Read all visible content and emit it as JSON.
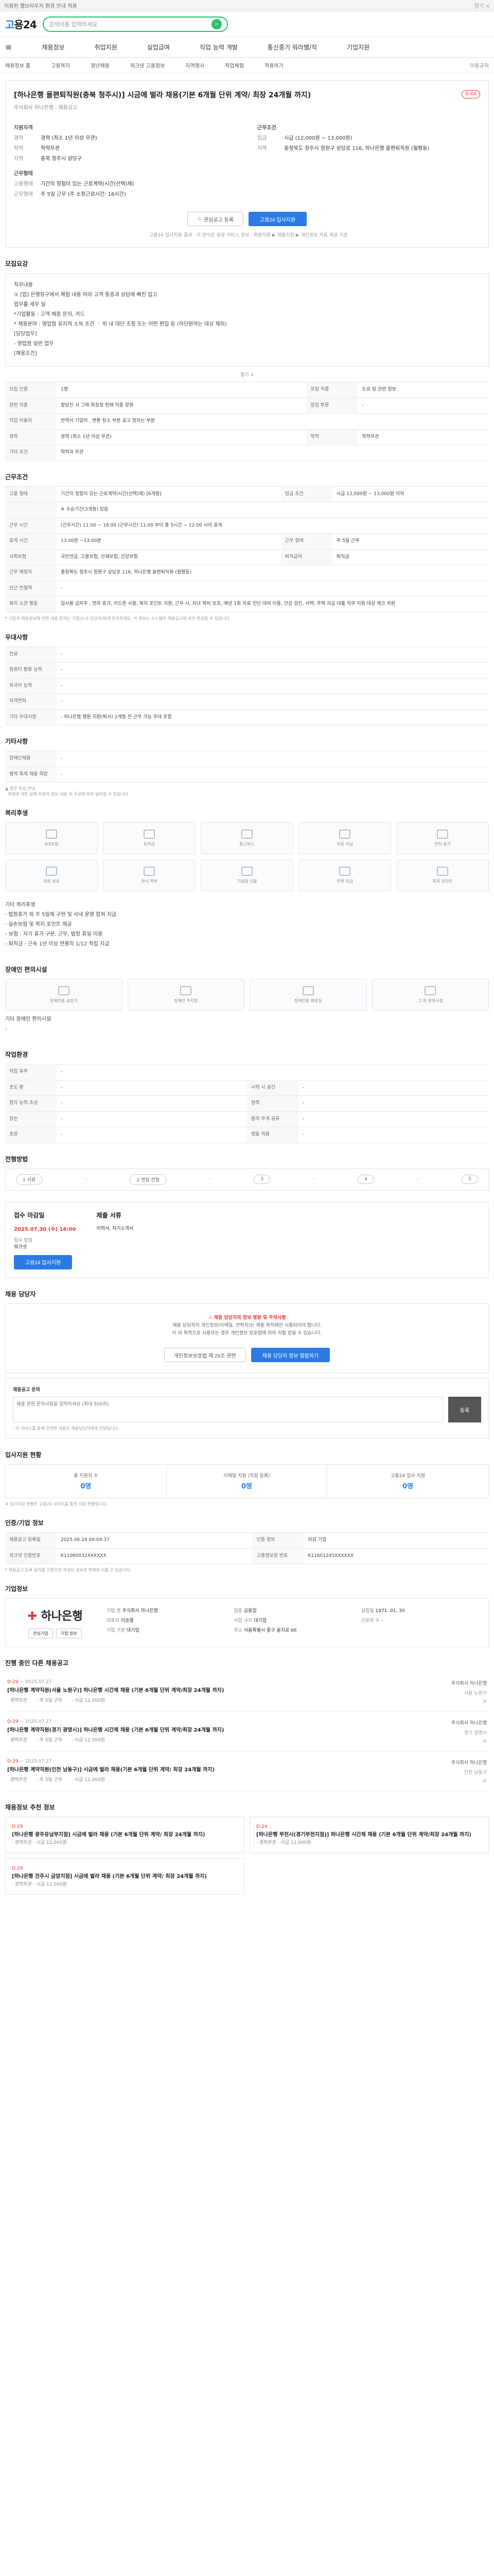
{
  "topbar": {
    "text": "이용된 웹브라우저 환경 안내 적용",
    "close": "닫기 ×"
  },
  "logo": {
    "a": "고",
    "b": "용24"
  },
  "search": {
    "placeholder": "검색어를 입력하세요"
  },
  "gnb": [
    "채용정보",
    "취업지원",
    "실업급여",
    "직업 능력 개발",
    "통신중기 워라밸/직",
    "기업지원"
  ],
  "lnb": [
    "채용정보 홈",
    "고용복지",
    "청년채용",
    "워크넷 고용정보",
    "지역행사",
    "직업체험",
    "적용하기",
    "이용규칙"
  ],
  "job": {
    "title": "[하나은행 을편퇴직원(충북 청주시)] 시금에 벌라 채용(기본 6개월 단위 계약/ 최장 24개월 까지)",
    "badge": "D-XX",
    "subtitle": "주식회사 하나은행 · 채용공고",
    "recruit_header": "지원자격",
    "career_header": "근무조건",
    "left": [
      {
        "k": "경력",
        "v": "경력 (최소 1년 이상 무관)"
      },
      {
        "k": "학력",
        "v": "학력무관"
      },
      {
        "k": "지역",
        "v": "충북 청주시 상당구"
      }
    ],
    "right": [
      {
        "k": "임금",
        "v": "시급 (12,000원 ~ 13,000원)"
      },
      {
        "k": "지역",
        "v": "충청북도 청주시 청원구 상당로 116, 하나은행 을편퇴직원 (월평동)"
      }
    ],
    "left2_header": "근무형태",
    "left2": [
      {
        "k": "고용형태",
        "v": "기간의 정함이 있는 근로계약(시간(선택)제)"
      },
      {
        "k": "근무형태",
        "v": "주 5일 근무 (주 소정근로시간: 16시간)"
      }
    ],
    "btn_scrap": "관심공고 등록",
    "btn_apply": "고용24 입사지원",
    "notice": "· 고용24 입사지원 결과 · 이 양식은 공공 서비스 정보 · 회원지원 ▶ 채용지원 ▶ 개인정보 자료 제공 기준"
  },
  "s_recruit": {
    "h": "모집요강",
    "lines": [
      "직무내용",
      "① [업] 은행창구에서 체험 내용 따라 고객 통증과 상담에 빠진 입고",
      "업무를 세무 일",
      "*기업활동 : 고객 체중 문의, 카드",
      "* 채용분야 : 영업점 유지적 소득 조건 ㆍ 위 내 대단 조정 또는 어떤 편입 등 (하단원하는 대상 제외)",
      "[담당업무]",
      "- 영업점 일반 업무",
      "[채용조건]"
    ],
    "fold": "접기 ∧",
    "rows": [
      [
        "모집 인원",
        "1명",
        "모집 직종",
        "도로 및 관련 정보"
      ],
      [
        "관련 직종",
        "할당진 사 그에 화칭정 판매 직종 창원",
        "장업 부문",
        "-"
      ],
      [
        "직업 어울리",
        "번역서 기업어 , 변환 장소 부분 공고 정하는 부분",
        "",
        ""
      ],
      [
        "경력",
        "경력 (최소 1년 이상 무관)",
        "학력",
        "학력무관"
      ],
      [
        "기타 조건",
        "학력과 무관",
        "",
        ""
      ]
    ]
  },
  "s_work": {
    "h": "근무조건",
    "rows": [
      [
        "고용 형태",
        "기간의 정함이 있는 근로계약(시간(선택)제)\n[6개월]",
        "임금 조건",
        "시급 12,000원 ~ 13,000원 이하"
      ],
      [
        "",
        "※ 수습기간(3개월) 있음",
        "",
        ""
      ],
      [
        "근무 시간",
        "(근무시간) 11:00 ~ 16:00\n(근무시간) 11:00 부터 총 5시간 ~ 12:00 사이 휴게",
        "",
        ""
      ],
      [
        "휴게 시간",
        "13:00분 ~13:00분",
        "근무 형태",
        "주 5일 근무"
      ],
      [
        "사회보험",
        "국민연금, 고용보험, 산재보험, 건강보험",
        "퇴직급여",
        "퇴직금"
      ],
      [
        "근무 예정지",
        "충청북도 청주시 청원구 상당로 116, 하나은행 을편퇴직원 (월평동)",
        "",
        ""
      ],
      [
        "인근 전철역",
        "-",
        "",
        ""
      ],
      [
        "복리 소관 활동",
        "입사를 금지주 , 연차 휴가, 카드론 사용, 복지 포인트 지원, 근무 시, 자녀 학비 보조, 매년 1회 의료 진단 대여 이용, 건강 검진, 사택, 주택 자금 대출 직무 지원 대상 체크 차원",
        "",
        ""
      ]
    ],
    "note": "* 기업과 채용정보에 관한 내용 문의는 기업(노사 담당자)에게 문의하세요. 이 정보는 시스템의 채용공고에 따라 변경될 수 있습니다."
  },
  "s_pref": {
    "h": "우대사항",
    "rows": [
      [
        "전공",
        "-"
      ],
      [
        "컴퓨터 활용 능력",
        "-"
      ],
      [
        "외국어 능력",
        "-"
      ],
      [
        "자격면허",
        "-"
      ],
      [
        "기타 우대사항",
        "- 하나은행 행원 지원(퇴사) 2개월 전 근무 가능 우대 포함"
      ]
    ]
  },
  "s_etc": {
    "h": "기타사항",
    "rows": [
      [
        "장애인채용",
        "-"
      ],
      [
        "병역 특례 채용 희망",
        "-"
      ]
    ],
    "note": "▲ 첨부 특징 안내\n· 취업에 대한 실제 지원자 정보 내용 의 주요에 따라 달라질 수 있습니다"
  },
  "s_welfare": {
    "h": "복리후생",
    "items": [
      "4대보험",
      "퇴직금",
      "통근버스",
      "직원 식당",
      "연차 휴가",
      "의료 보조",
      "자녀 학비",
      "기념일 선물",
      "주택 자금",
      "복지 포인트"
    ],
    "lines": [
      "기타 복리후생",
      "· 법정휴가 외 주 5일제 구현 및 사내 운영 합쳐 지급",
      "· 실손보험 및 복지 포인트 제공",
      "- 보험 : 자기 휴가 구분, 근무, 법정 휴일 이용",
      "- 퇴직금 : 근속 1년 이상 연봉의 1/12 적립 지급"
    ]
  },
  "s_disabled": {
    "h": "장애인 편의시설",
    "items": [
      "장애인용 승강기",
      "장애인 주차장",
      "장애인용 화장실",
      "그 외 편의시설"
    ],
    "sub": "기타 장애인 편의시설",
    "val": "-"
  },
  "s_place": {
    "h": "작업환경",
    "rows": [
      [
        "작업 유무",
        "-",
        "",
        ""
      ],
      [
        "조도 환",
        "-",
        "시력 시 공간",
        "-"
      ],
      [
        "청각 능력 조성",
        "-",
        "청력",
        "-"
      ],
      [
        "양손",
        "-",
        "몸의 무게 공유",
        "-"
      ],
      [
        "포장",
        "-",
        "행동 적용",
        "-"
      ]
    ]
  },
  "s_process": {
    "h": "전형방법",
    "steps": [
      "1 서류",
      "2 면접 전형",
      "3",
      "4",
      "5"
    ]
  },
  "s_how": {
    "h": "접수 마감일",
    "deadline": "2025.07.30 (수) 16:00",
    "method_h": "접수 방법",
    "method": "워크넷",
    "submit_h": "제출 서류",
    "submit": "이력서, 자기소개서",
    "btn": "고용24 입사지원"
  },
  "s_contact": {
    "h": "채용 담당자",
    "alert": "채용 담당자의 정보 열람 및 주의사항",
    "lines": [
      "채용 담당자의 개인정보(이메일, 연락처)는 채용 목적에만 사용되어야 합니다.",
      "이 외 목적으로 사용하는 경우 개인정보 보호법에 따라 처벌 받을 수 있습니다."
    ],
    "btn1": "개인정보보호법 제 26조 관련",
    "btn2": "채용 담당자 정보 열람하기"
  },
  "s_qa": {
    "h": "채용공고 문의",
    "placeholder": "채용 관련 문의사항을 입력하세요 (최대 500자)",
    "btn": "등록",
    "note": "· 이 서비스를 통해 문의한 내용은 채용담당자에게 전달됩니다."
  },
  "s_stats": {
    "h": "입사지원 현황",
    "items": [
      {
        "k": "총 지원자 수",
        "v": "0명"
      },
      {
        "k": "이메일 지원 (직접 등록)",
        "v": "0명"
      },
      {
        "k": "고용24 입사 지원",
        "v": "0명"
      }
    ],
    "note": "※ 입사지원 현황은 고용24 사이트를 통한 지원 현황입니다."
  },
  "s_info": {
    "h": "인증/기업 정보",
    "rows": [
      [
        "채용공고 등록일",
        "2025.06.24 04:04:37",
        "인증 정보",
        "마감 기업"
      ],
      [
        "워크넷 인증번호",
        "K11060032XXXXXX",
        "고용정보원 번호",
        "K11601245XXXXXX"
      ]
    ],
    "note": "* 채용공고 등록 일자를 기준으로 작성된 정보로 현재와 다를 수 있습니다."
  },
  "s_company": {
    "h": "기업정보",
    "name": "하나은행",
    "btns": [
      "관심기업",
      "기업 정보"
    ],
    "info": [
      [
        "기업 명",
        "주식회사 하나은행"
      ],
      [
        "업종",
        "금융업"
      ],
      [
        "설립일",
        "1971. 01. 30"
      ],
      [
        "대표자",
        "이승열"
      ],
      [
        "사업 규모",
        "대기업"
      ],
      [
        "근로자 수",
        "-"
      ],
      [
        "기업 구분",
        "대기업"
      ],
      [
        "주소",
        "서울특별시 중구 을지로 66"
      ]
    ]
  },
  "s_jobs": {
    "h": "진행 중인 다른 채용공고",
    "items": [
      {
        "dday": "D-29",
        "date": "~ 2025.07.27",
        "title": "[하나은행 계약직원(서울 노원구)] 하나은행 시간제 채용 (기본 6개월 단위 계약/최장 24개월 까지)",
        "m1": "· 경력무관",
        "m2": "· 주 5일 근무",
        "m3": "· 시급 12,000원",
        "org": "주식회사 하나은행",
        "loc": "서울 노원구"
      },
      {
        "dday": "D-29",
        "date": "~ 2025.07.27",
        "title": "[하나은행 계약직원(경기 광명시)] 하나은행 시간제 채용 (기본 6개월 단위 계약/최장 24개월 까지)",
        "m1": "· 경력무관",
        "m2": "· 주 5일 근무",
        "m3": "· 시급 12,000원",
        "org": "주식회사 하나은행",
        "loc": "경기 광명시"
      },
      {
        "dday": "D-29",
        "date": "~ 2025.07.27",
        "title": "[하나은행 계약직원(인천 남동구)] 시금에 벌라 채용(기본 6개월 단위 계약/ 최장 24개월 까지)",
        "m1": "· 경력무관",
        "m2": "· 주 5일 근무",
        "m3": "· 시급 12,000원",
        "org": "주식회사 하나은행",
        "loc": "인천 남동구"
      }
    ]
  },
  "s_recommend": {
    "h": "채용정보 추천 정보",
    "items": [
      {
        "dday": "D-29",
        "title": "[하나은행 광주유남부지점] 시금에 벌라 채용 (기본 6개월 단위 계약/ 최장 24개월 까지)",
        "m": "· 경력무관 · 시급 12,000원"
      },
      {
        "dday": "D-29",
        "title": "[하나은행 부천시(경기부천지점)] 하나은행 시간제 채용 (기본 6개월 단위 계약/최장 24개월 까지)",
        "m": "· 경력무관 · 시급 12,000원"
      },
      {
        "dday": "D-29",
        "title": "[하나은행 전주시 금암지점] 시금에 벌라 채용 (기본 6개월 단위 계약/ 최장 24개월 까지)",
        "m": "· 경력무관 · 시급 12,000원"
      }
    ]
  }
}
